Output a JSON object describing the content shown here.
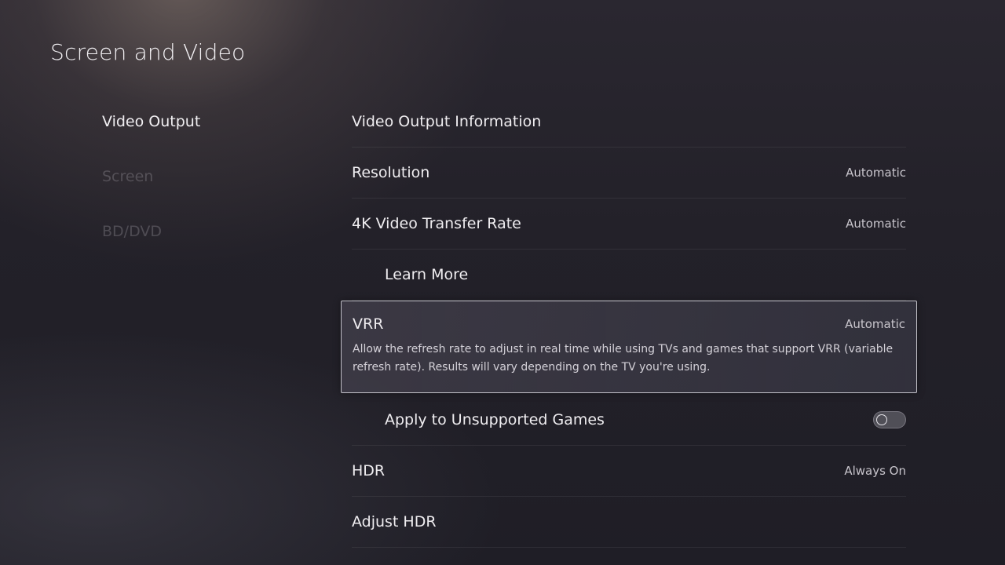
{
  "page": {
    "title": "Screen and Video"
  },
  "sidebar": {
    "items": [
      {
        "label": "Video Output",
        "active": true
      },
      {
        "label": "Screen",
        "active": false
      },
      {
        "label": "BD/DVD",
        "active": false
      }
    ]
  },
  "settings": {
    "rows": [
      {
        "label": "Video Output Information",
        "value": ""
      },
      {
        "label": "Resolution",
        "value": "Automatic"
      },
      {
        "label": "4K Video Transfer Rate",
        "value": "Automatic"
      },
      {
        "label": "Learn More",
        "value": ""
      },
      {
        "label": "VRR",
        "value": "Automatic",
        "description": "Allow the refresh rate to adjust in real time while using TVs and games that support VRR (variable refresh rate). Results will vary depending on the TV you're using."
      },
      {
        "label": "Apply to Unsupported Games",
        "toggle_on": false
      },
      {
        "label": "HDR",
        "value": "Always On"
      },
      {
        "label": "Adjust HDR",
        "value": ""
      }
    ]
  }
}
